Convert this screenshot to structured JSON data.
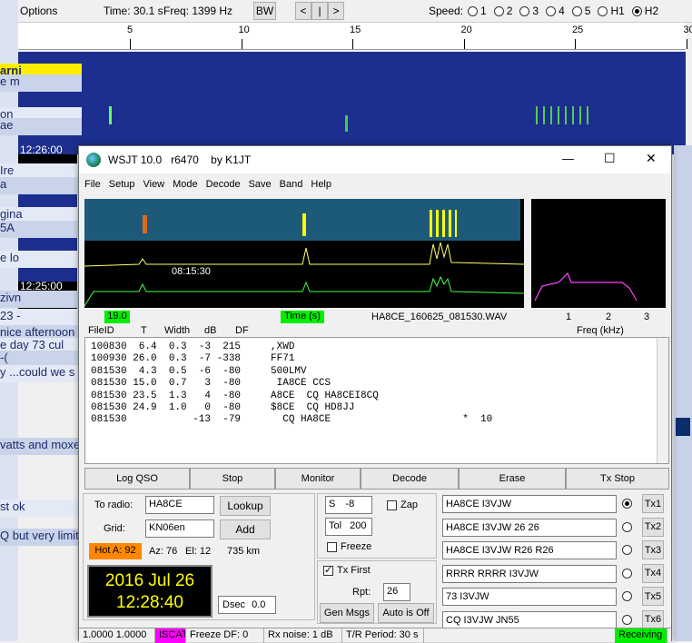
{
  "bg_toolbar": {
    "options": "Options",
    "time": "Time: 30.1 s",
    "freq": "Freq: 1399 Hz",
    "bw": "BW",
    "prev": "<",
    "mid": "|",
    "next": ">",
    "speed_label": "Speed:",
    "speeds": [
      "1",
      "2",
      "3",
      "4",
      "5",
      "H1",
      "H2"
    ]
  },
  "bg_ruler_ticks": [
    "5",
    "10",
    "15",
    "20",
    "25",
    "30"
  ],
  "bg_times": [
    "12:26:00",
    "12:25:00"
  ],
  "bg_strip_rows": [
    "arni",
    "e m",
    "on",
    "ae",
    "Ire",
    "a",
    "gina",
    "5A",
    "e lo",
    "zivn",
    "23 -",
    "nice afternoon",
    "e day 73 cul",
    "-(",
    "y ...could we s",
    "vatts and moxe",
    "st ok",
    "Q but very limit"
  ],
  "window": {
    "title": "WSJT 10.0   r6470    by K1JT",
    "controls": [
      "—",
      "☐",
      "✕"
    ]
  },
  "menu": [
    "File",
    "Setup",
    "View",
    "Mode",
    "Decode",
    "Save",
    "Band",
    "Help"
  ],
  "spec_time": "08:15:30",
  "bottom_labels": {
    "df_value": "19.0",
    "time_label": "Time (s)",
    "filename": "HA8CE_160625_081530.WAV",
    "freq_ticks": [
      "1",
      "2",
      "3"
    ],
    "freq_label": "Freq (kHz)"
  },
  "decode_header": [
    "FileID",
    "T",
    "Width",
    "dB",
    "DF"
  ],
  "decodes": [
    "100830  6.4  0.3  -3  215     ,XWD",
    "100930 26.0  0.3  -7 -338     FF71",
    "081530  4.3  0.5  -6  -80     500LMV",
    "081530 15.0  0.7   3  -80      IA8CE CCS",
    "081530 23.5  1.3   4  -80     A8CE  CQ HA8CEI8CQ",
    "081530 24.9  1.0   0  -80     $8CE  CQ HD8JJ",
    "081530           -13  -79       CQ HA8CE                      *  10"
  ],
  "controls": [
    "Log QSO",
    "Stop",
    "Monitor",
    "Decode",
    "Erase",
    "Tx Stop"
  ],
  "station": {
    "to_radio_label": "To radio:",
    "to_radio": "HA8CE",
    "grid_label": "Grid:",
    "grid": "KN06en",
    "lookup": "Lookup",
    "add": "Add",
    "hot": "Hot A: 92",
    "az": "Az: 76",
    "el": "El: 12",
    "dist": "735 km",
    "date": "2016 Jul 26",
    "clock": "12:28:40",
    "dsec_label": "Dsec",
    "dsec": "0.0"
  },
  "mid_panel": {
    "s_label": "S",
    "s_value": "-8",
    "zap": "Zap",
    "tol_label": "Tol",
    "tol": "200",
    "freeze": "Freeze",
    "tx_first": "Tx First",
    "rpt_label": "Rpt:",
    "rpt": "26",
    "gen_msgs": "Gen Msgs",
    "auto": "Auto is Off"
  },
  "tx": [
    {
      "msg": "HA8CE I3VJW",
      "btn": "Tx1"
    },
    {
      "msg": "HA8CE I3VJW 26 26",
      "btn": "Tx2"
    },
    {
      "msg": "HA8CE I3VJW R26 R26",
      "btn": "Tx3"
    },
    {
      "msg": "RRRR RRRR I3VJW",
      "btn": "Tx4"
    },
    {
      "msg": "73 I3VJW",
      "btn": "Tx5"
    },
    {
      "msg": "CQ I3VJW JN55",
      "btn": "Tx6"
    }
  ],
  "status": {
    "s1": "1.0000 1.0000",
    "s2": "ISCAT",
    "s3": "Freeze DF:    0",
    "s4": "Rx noise:   1 dB",
    "s5": "T/R Period: 30 s",
    "s6": "Receiving"
  },
  "colors": {
    "green": "#00ee00",
    "hot": "#ff8800",
    "magenta": "#ff00ff",
    "lcd_text": "#ffff00"
  }
}
